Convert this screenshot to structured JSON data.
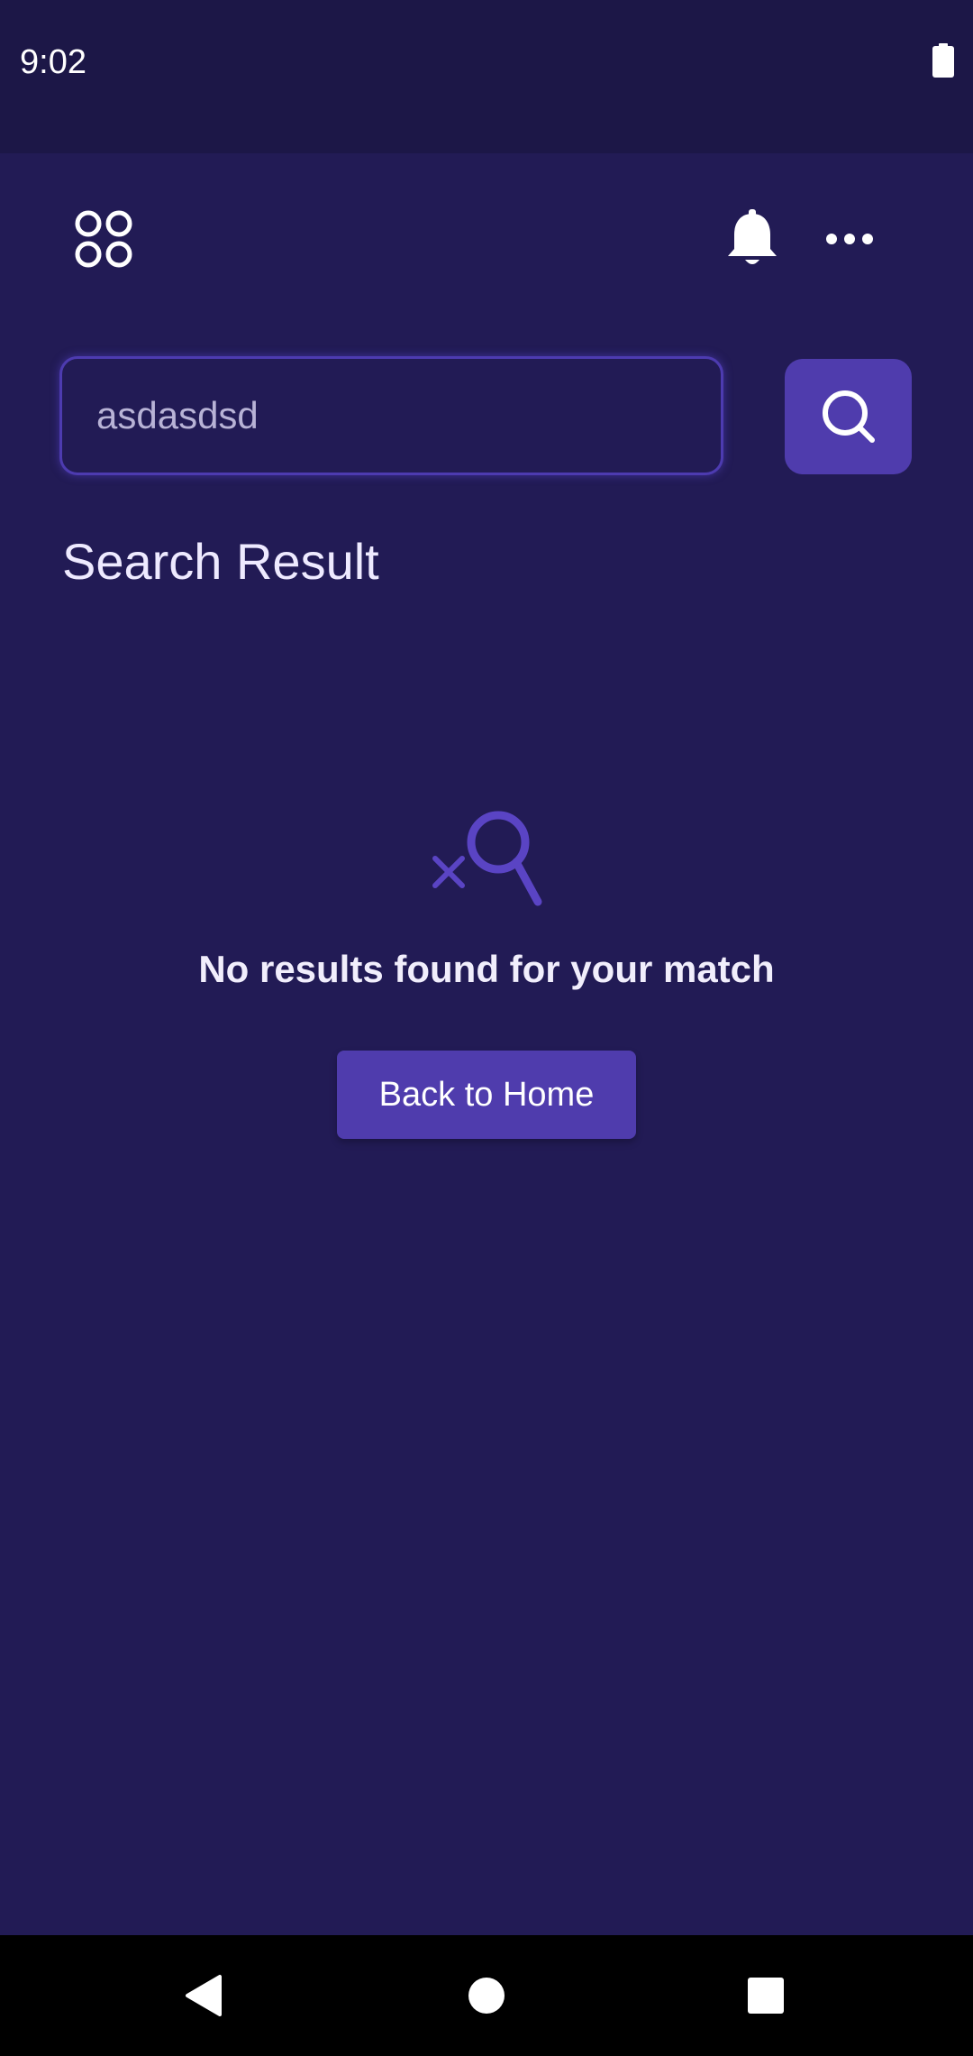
{
  "status_bar": {
    "time": "9:02"
  },
  "app_bar": {
    "menu_icon": "grid-circles-icon",
    "notification_icon": "bell-icon",
    "more_icon": "more-horizontal-icon"
  },
  "search": {
    "value": "asdasdsd",
    "button_icon": "search-icon"
  },
  "results": {
    "title": "Search Result",
    "empty_icon": "search-off-icon",
    "empty_message": "No results found for your match",
    "back_button_label": "Back to Home"
  },
  "colors": {
    "background": "#221b55",
    "status_bar": "#1c1747",
    "accent": "#4f3cad",
    "text": "#eeeaff"
  },
  "nav_bar": {
    "back_icon": "back-triangle-icon",
    "home_icon": "home-circle-icon",
    "recents_icon": "recents-square-icon"
  }
}
